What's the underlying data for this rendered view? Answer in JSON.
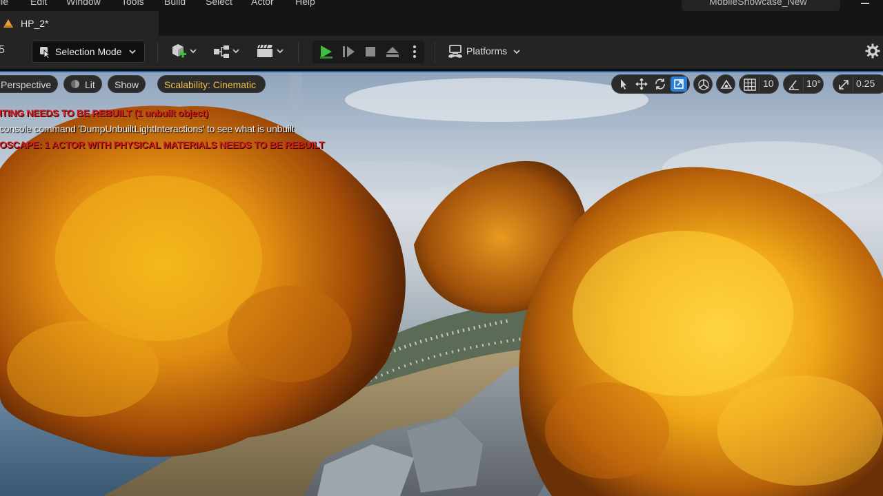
{
  "menu": {
    "items": [
      "ile",
      "Edit",
      "Window",
      "Tools",
      "Build",
      "Select",
      "Actor",
      "Help"
    ],
    "project_name": "MobileShowcase_New"
  },
  "tabs": {
    "level_tab": "HP_2*"
  },
  "toolbar": {
    "left_glyph": "5",
    "selection_mode": "Selection Mode",
    "platforms": "Platforms",
    "icons": [
      "add-actor-icon",
      "blueprint-icon",
      "cinematics-icon",
      "play-icon",
      "advance-frame-icon",
      "stop-icon",
      "eject-icon",
      "more-options-icon",
      "platforms-icon",
      "settings-icon"
    ],
    "play_color": "#3fbf3f"
  },
  "viewport": {
    "perspective": "Perspective",
    "lit": "Lit",
    "show": "Show",
    "scalability": "Scalability: Cinematic",
    "grid_snap": "10",
    "rotation_snap": "10°",
    "scale_snap": "0.25",
    "messages": {
      "lighting_warning": "ITING NEEDS TO BE REBUILT (1 unbuilt object)",
      "console_hint": "console command 'DumpUnbuiltLightInteractions' to see what is unbuilt",
      "landscape_warning": "OSCAPE: 1 ACTOR WITH PHYSICAL MATERIALS NEEDS TO BE REBUILT"
    },
    "warning_color": "#d21c1c",
    "active_tool_color": "#2c7fd6",
    "scalability_color": "#f0c24a"
  }
}
